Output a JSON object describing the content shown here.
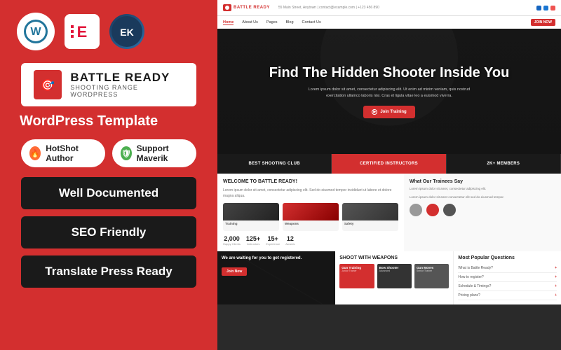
{
  "left_panel": {
    "icons": {
      "wordpress": "W",
      "elementor": "E",
      "ek": "EK"
    },
    "logo": {
      "title": "BATTLE READY",
      "subtitle": "SHOOTING RANGE WORDPRESS"
    },
    "template_label": "WordPress Template",
    "badges": [
      {
        "id": "hotshot",
        "icon": "🔥",
        "label": "HotShot Author"
      },
      {
        "id": "support",
        "icon": "🛡",
        "label": "Support Maverik"
      }
    ],
    "features": [
      "Well Documented",
      "SEO Friendly",
      "Translate Press Ready"
    ]
  },
  "right_panel": {
    "nav": {
      "logo": "BATTLE READY",
      "links": [
        "Home",
        "About Us",
        "Pages",
        "Blog",
        "Contact Us"
      ],
      "active_link": "Home",
      "cta": "JOIN NOW",
      "info": "55 Main Street, Anytown | contact@example.com | +123 456 890"
    },
    "hero": {
      "title": "Find The Hidden Shooter Inside You",
      "body": "Lorem ipsum dolor sit amet, consectetur adipiscing elit. Ut enim ad minim veniam, quis nostrud exercitation ullamco laboris nisi. Cras et ligula vitae leo a euismod viverra.",
      "cta": "Join Training"
    },
    "stats": [
      {
        "label": "Best Shooting Club",
        "active": false
      },
      {
        "label": "Certified Instructors",
        "active": true
      },
      {
        "label": "2k+ Members",
        "active": false
      }
    ],
    "section_left": {
      "title": "Welcome to Battle Ready!",
      "body": "Lorem ipsum dolor sit amet, consectetur adipiscing elit. Sed do eiusmod tempor incididunt ut labore et dolore magna aliqua.",
      "numbers": [
        {
          "val": "2,000",
          "label": "Happy Clients"
        },
        {
          "val": "125+",
          "label": "Instructors"
        },
        {
          "val": "15+",
          "label": "Experience"
        },
        {
          "val": "12",
          "label": "Awards"
        }
      ]
    },
    "section_right": {
      "title": "What Our Trainees Say",
      "body": "Lorem ipsum dolor sit amet, consectetur adipiscing elit."
    },
    "weapons": {
      "title": "Shoot with Weapons",
      "cards": [
        {
          "title": "Gun Training",
          "sub": "Junior Trainer"
        },
        {
          "title": "Bow Shooter",
          "sub": "Advanced"
        },
        {
          "title": "Gun Moves",
          "sub": "Senior Trainer"
        }
      ]
    },
    "register": {
      "title": "We are waiting for you to get registered.",
      "cta": "Join Now"
    },
    "faq": {
      "title": "Most Popular Questions",
      "items": [
        "What is Battle Ready?",
        "How to register?",
        "Schedule & Timings?",
        "Pricing plans?"
      ]
    }
  }
}
